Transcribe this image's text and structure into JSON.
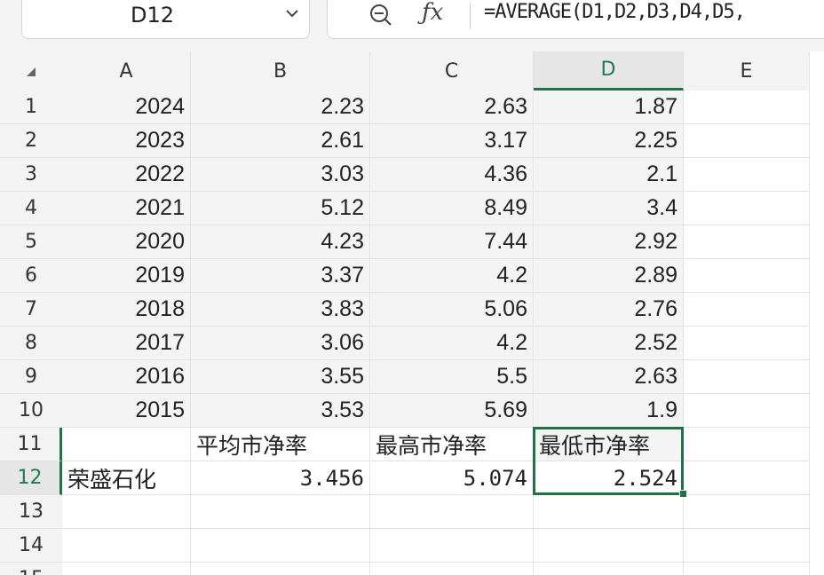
{
  "namebox": {
    "ref": "D12"
  },
  "formula_bar": {
    "formula": "=AVERAGE(D1,D2,D3,D4,D5,"
  },
  "columns": [
    "A",
    "B",
    "C",
    "D",
    "E"
  ],
  "rows": [
    "1",
    "2",
    "3",
    "4",
    "5",
    "6",
    "7",
    "8",
    "9",
    "10",
    "11",
    "12",
    "13",
    "14",
    "15"
  ],
  "data_rows": [
    [
      "2024",
      "2.23",
      "2.63",
      "1.87"
    ],
    [
      "2023",
      "2.61",
      "3.17",
      "2.25"
    ],
    [
      "2022",
      "3.03",
      "4.36",
      "2.1"
    ],
    [
      "2021",
      "5.12",
      "8.49",
      "3.4"
    ],
    [
      "2020",
      "4.23",
      "7.44",
      "2.92"
    ],
    [
      "2019",
      "3.37",
      "4.2",
      "2.89"
    ],
    [
      "2018",
      "3.83",
      "5.06",
      "2.76"
    ],
    [
      "2017",
      "3.06",
      "4.2",
      "2.52"
    ],
    [
      "2016",
      "3.55",
      "5.5",
      "2.63"
    ],
    [
      "2015",
      "3.53",
      "5.69",
      "1.9"
    ]
  ],
  "summary_headers": {
    "b": "平均市净率",
    "c": "最高市净率",
    "d": "最低市净率"
  },
  "summary_row": {
    "a": "荣盛石化",
    "b": "3.456",
    "c": "5.074",
    "d": "2.524"
  },
  "selected": {
    "column": "D",
    "row": "12"
  },
  "colors": {
    "accent": "#217346",
    "header_bg": "#f3f3f3",
    "gridline": "#e3e3e3"
  },
  "icons": [
    "chevron-down-icon",
    "zoom-icon",
    "fx-icon",
    "select-all-icon",
    "fill-handle-icon"
  ]
}
